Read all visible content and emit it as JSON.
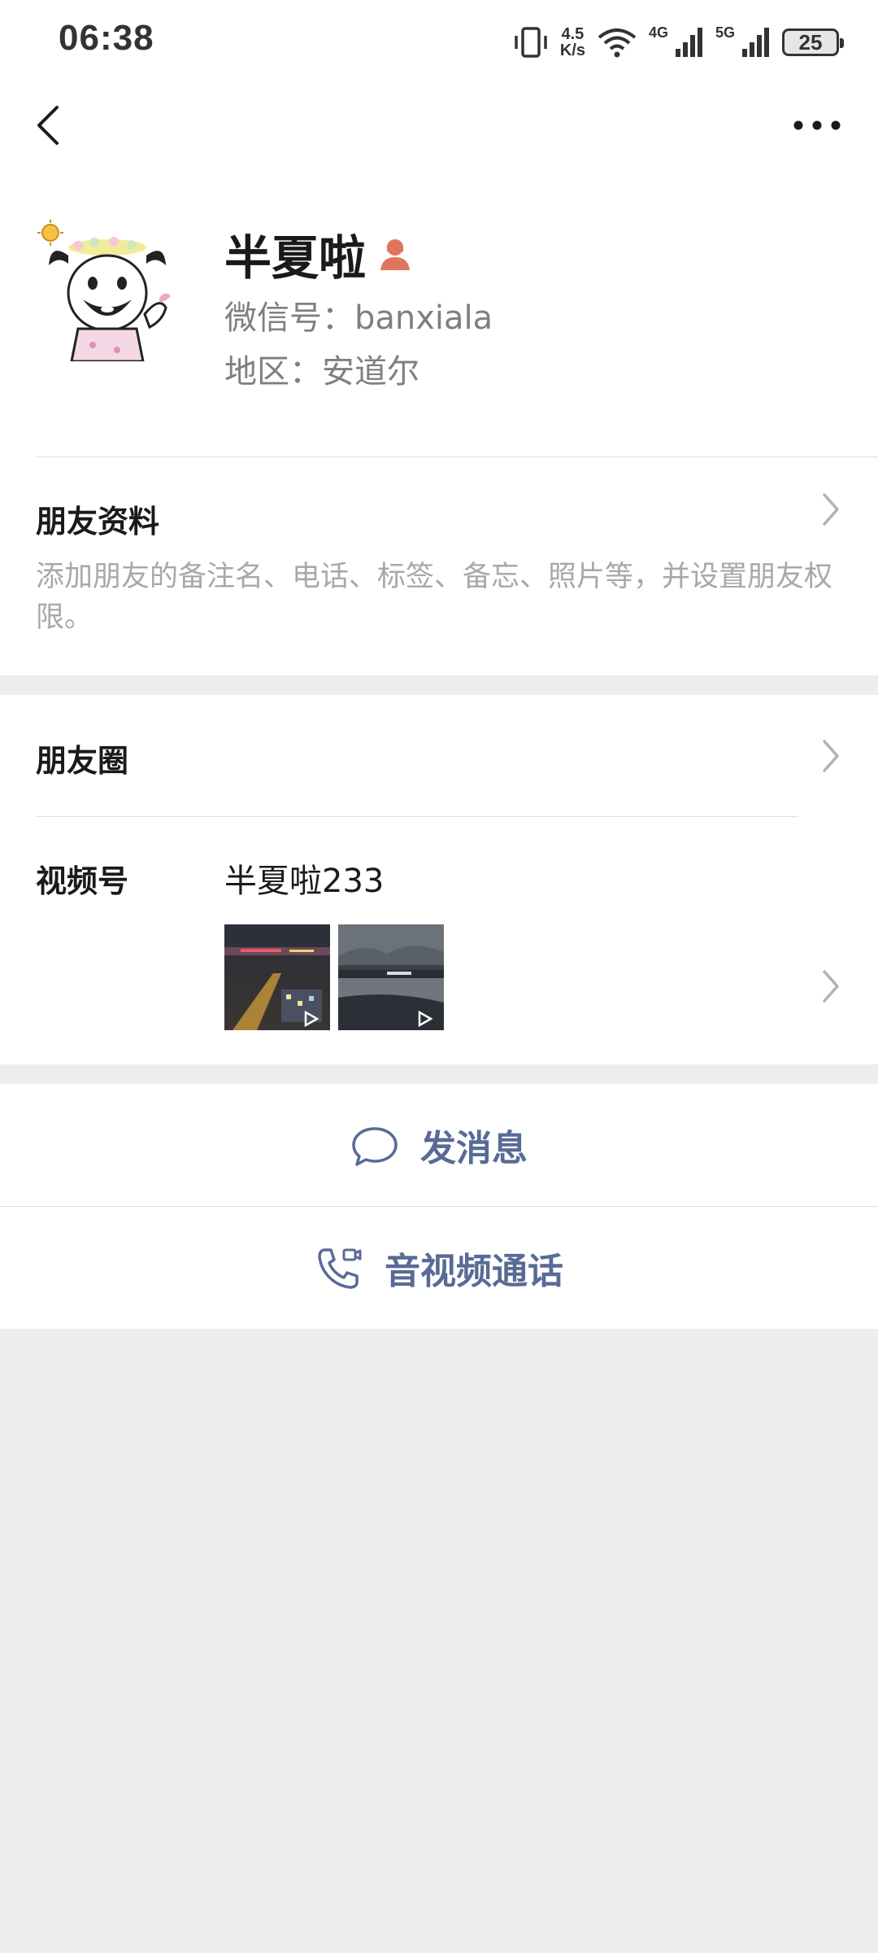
{
  "status_bar": {
    "time": "06:38",
    "net_speed_value": "4.5",
    "net_speed_unit": "K/s",
    "network_1": "4G",
    "network_2": "5G",
    "battery": "25"
  },
  "profile": {
    "nickname": "半夏啦",
    "wechat_id": "微信号：banxiala",
    "region": "地区：安道尔",
    "gender_icon": "female-icon"
  },
  "friend_info": {
    "title": "朋友资料",
    "description": "添加朋友的备注名、电话、标签、备忘、照片等，并设置朋友权限。"
  },
  "moments": {
    "title": "朋友圈"
  },
  "channels": {
    "title": "视频号",
    "channel_name": "半夏啦233"
  },
  "actions": {
    "message": "发消息",
    "call": "音视频通话"
  },
  "colors": {
    "link_blue": "#576b95",
    "gender_female": "#e0745c",
    "background": "#ededed"
  }
}
